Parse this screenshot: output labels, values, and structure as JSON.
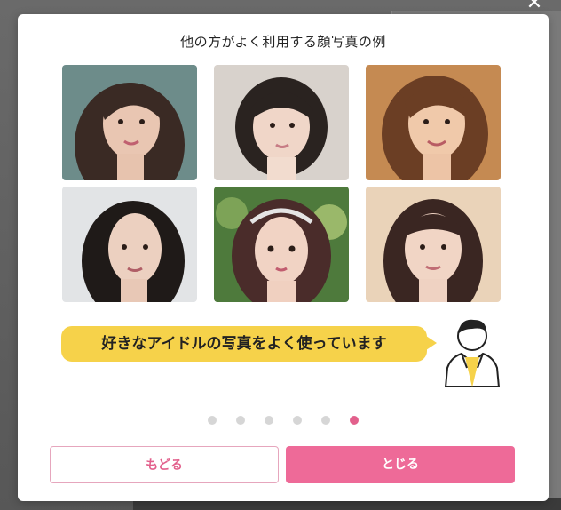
{
  "modal": {
    "title": "他の方がよく利用する顔写真の例",
    "photos": [
      {
        "label": "example-face-1"
      },
      {
        "label": "example-face-2"
      },
      {
        "label": "example-face-3"
      },
      {
        "label": "example-face-4"
      },
      {
        "label": "example-face-5"
      },
      {
        "label": "example-face-6"
      }
    ],
    "speech_bubble": "好きなアイドルの写真をよく使っています",
    "pagination": {
      "total": 6,
      "current": 6
    },
    "buttons": {
      "back": "もどる",
      "close": "とじる"
    }
  },
  "overlay": {
    "close_glyph": "✕"
  },
  "colors": {
    "accent": "#ee6a98",
    "bubble": "#f6d24a",
    "dot_active": "#e2608c",
    "dot_inactive": "#d6d6d6"
  }
}
